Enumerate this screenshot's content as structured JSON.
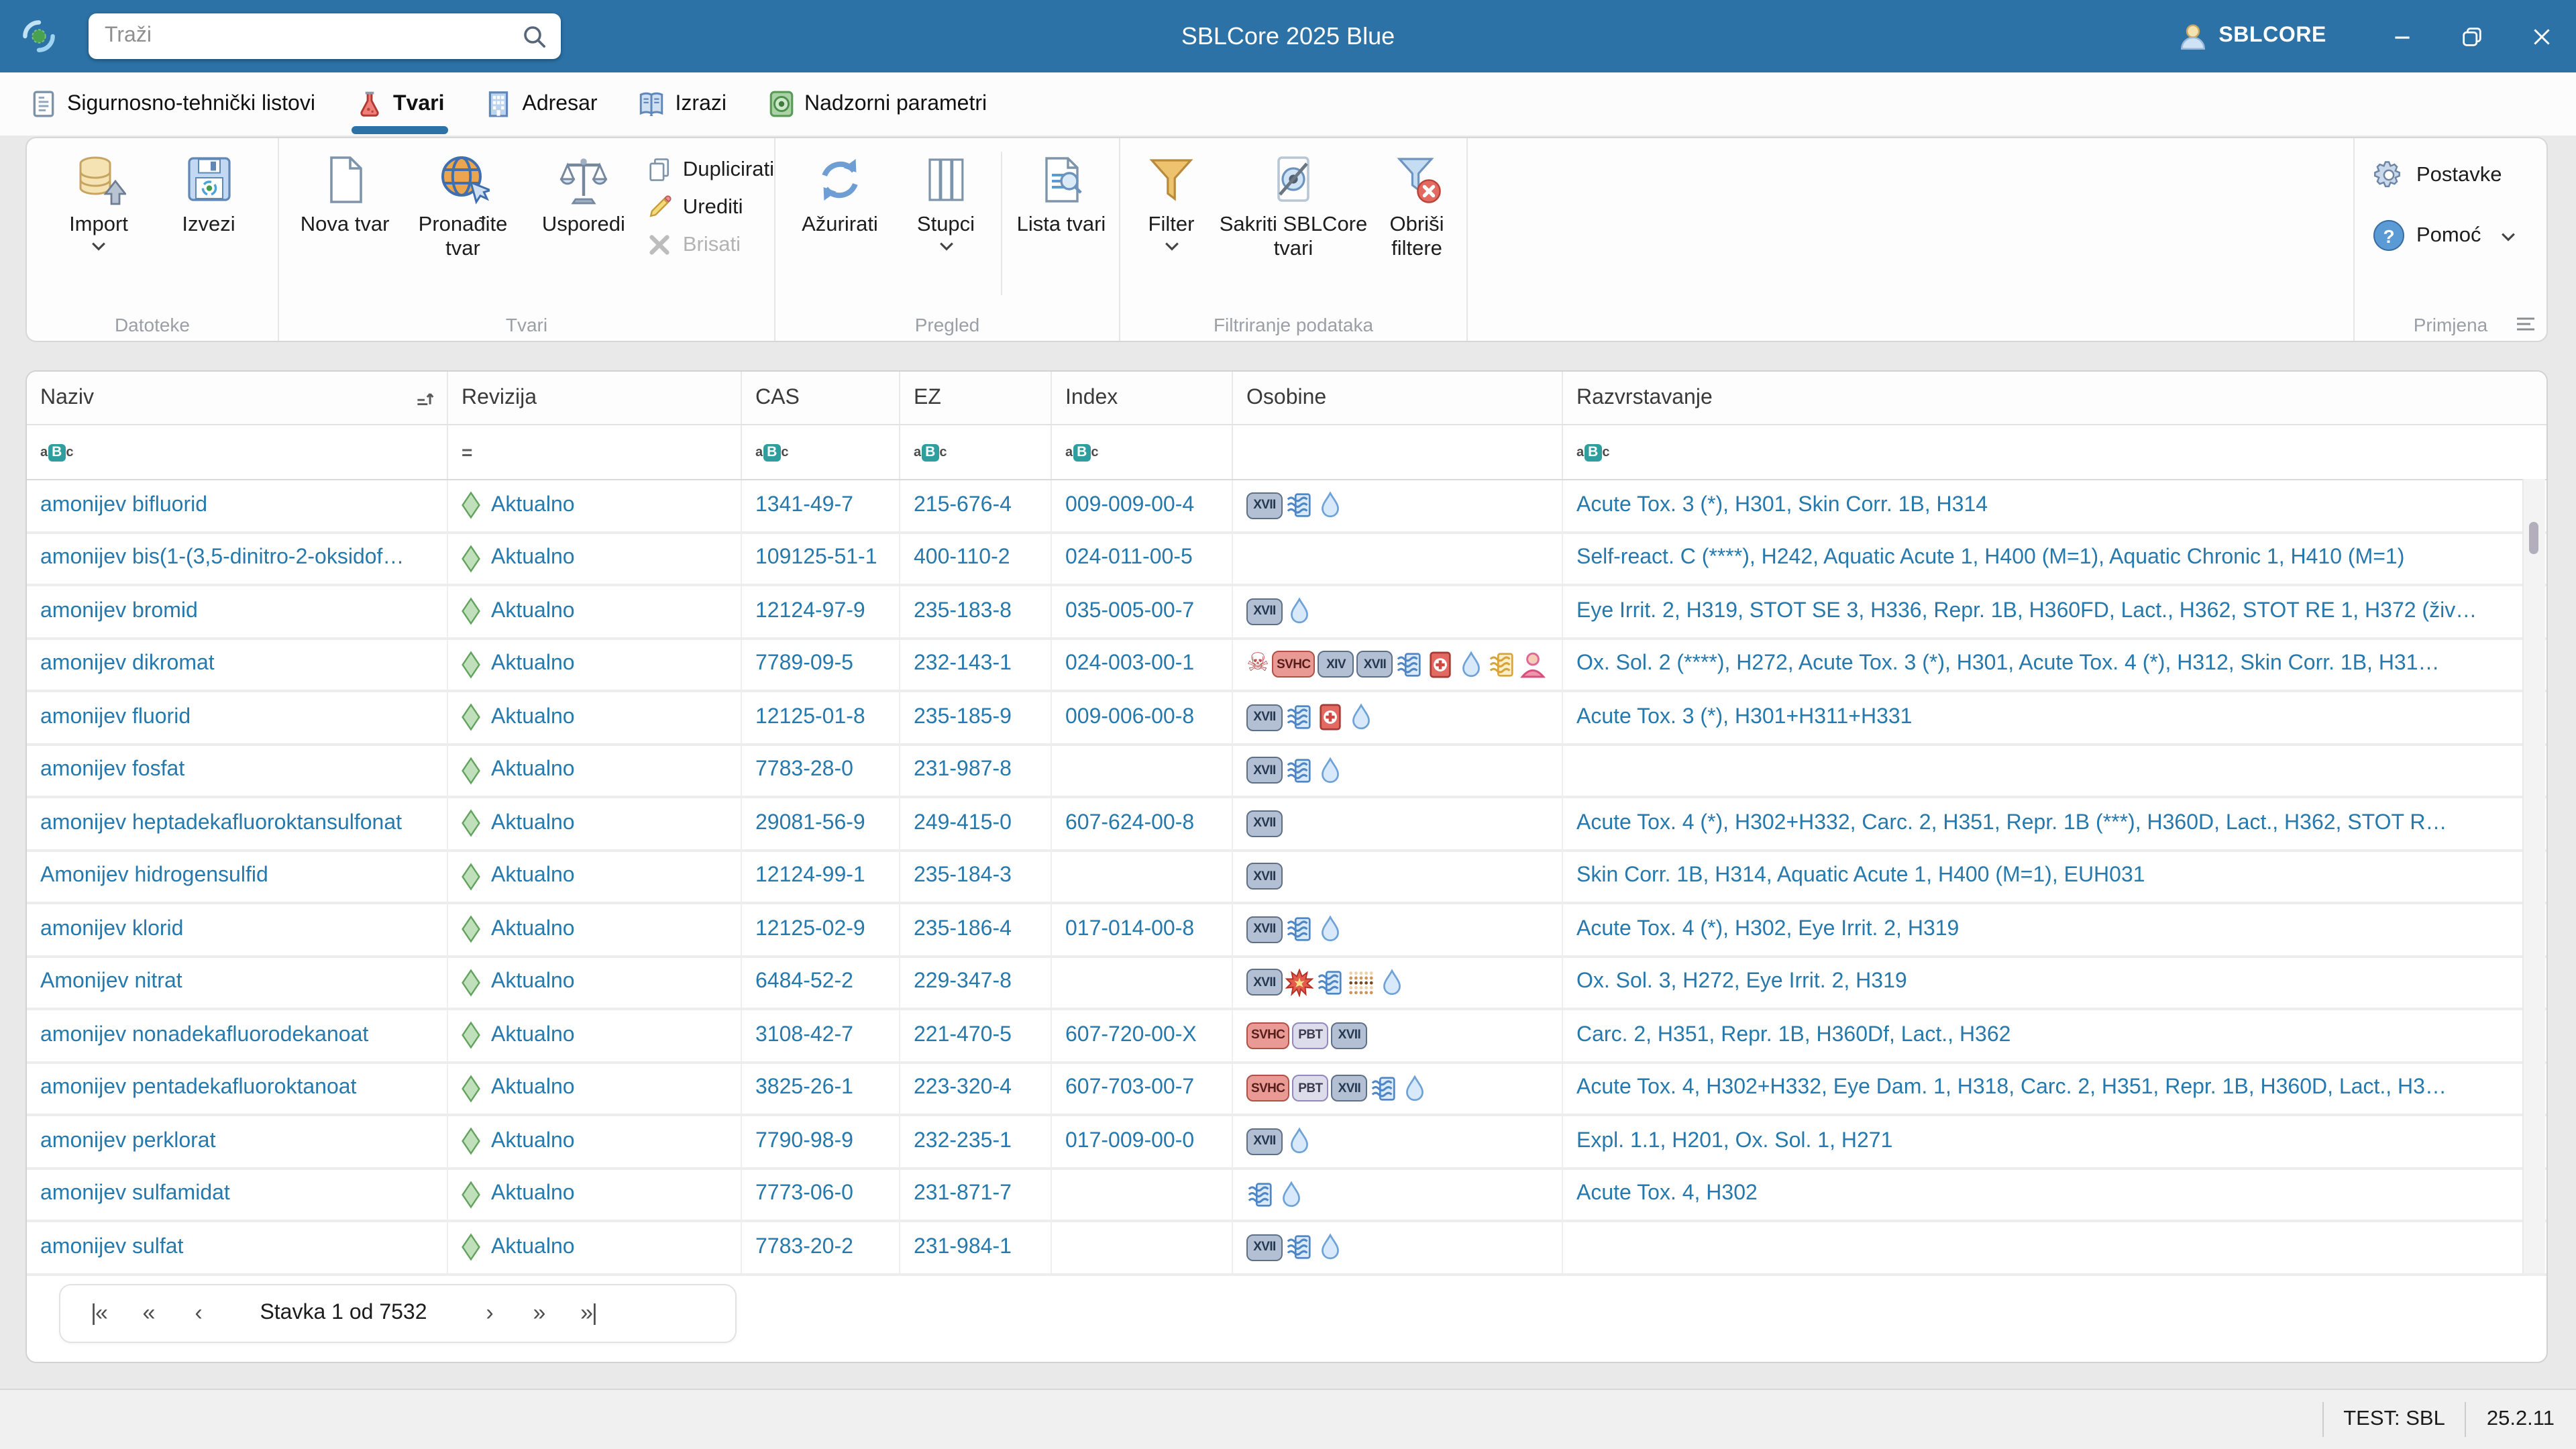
{
  "window": {
    "title": "SBLCore 2025 Blue",
    "user": "SBLCORE",
    "search_placeholder": "Traži"
  },
  "tabs": [
    {
      "label": "Sigurnosno-tehnički listovi",
      "active": false
    },
    {
      "label": "Tvari",
      "active": true
    },
    {
      "label": "Adresar",
      "active": false
    },
    {
      "label": "Izrazi",
      "active": false
    },
    {
      "label": "Nadzorni parametri",
      "active": false
    }
  ],
  "ribbon": {
    "groups": [
      {
        "label": "Datoteke",
        "buttons": [
          {
            "label": "Import",
            "dropdown": true
          },
          {
            "label": "Izvezi",
            "dropdown": false
          }
        ]
      },
      {
        "label": "Tvari",
        "buttons": [
          {
            "label": "Nova tvar",
            "dropdown": false
          },
          {
            "label": "Pronađite tvar",
            "dropdown": false
          },
          {
            "label": "Usporedi",
            "dropdown": false
          }
        ],
        "small_buttons": [
          {
            "label": "Duplicirati",
            "disabled": false
          },
          {
            "label": "Urediti",
            "disabled": false
          },
          {
            "label": "Brisati",
            "disabled": true
          }
        ]
      },
      {
        "label": "Pregled",
        "buttons": [
          {
            "label": "Ažurirati",
            "dropdown": false
          },
          {
            "label": "Stupci",
            "dropdown": true
          },
          {
            "label": "Lista tvari",
            "dropdown": false
          }
        ]
      },
      {
        "label": "Filtriranje podataka",
        "buttons": [
          {
            "label": "Filter",
            "dropdown": true
          },
          {
            "label": "Sakriti SBLCore tvari",
            "dropdown": false
          },
          {
            "label": "Obriši filtere",
            "dropdown": false
          }
        ]
      },
      {
        "label": "Primjena",
        "buttons": [
          {
            "label": "Postavke",
            "dropdown": false
          },
          {
            "label": "Pomoć",
            "dropdown": true
          }
        ]
      }
    ]
  },
  "table": {
    "columns": [
      {
        "label": "Naziv",
        "filter": "abc",
        "sorted": true
      },
      {
        "label": "Revizija",
        "filter": "eq",
        "sorted": false
      },
      {
        "label": "CAS",
        "filter": "abc",
        "sorted": false
      },
      {
        "label": "EZ",
        "filter": "abc",
        "sorted": false
      },
      {
        "label": "Index",
        "filter": "abc",
        "sorted": false
      },
      {
        "label": "Osobine",
        "filter": null,
        "sorted": false
      },
      {
        "label": "Razvrstavanje",
        "filter": "abc",
        "sorted": false
      }
    ],
    "rows": [
      {
        "name": "amonijev bifluorid",
        "revision": "Aktualno",
        "cas": "1341-49-7",
        "ez": "215-676-4",
        "index": "009-009-00-4",
        "props": [
          "reach-xvii",
          "vapour",
          "droplet"
        ],
        "classification": "Acute Tox. 3 (*), H301, Skin Corr. 1B, H314"
      },
      {
        "name": "amonijev bis(1-(3,5-dinitro-2-oksidof…",
        "revision": "Aktualno",
        "cas": "109125-51-1",
        "ez": "400-110-2",
        "index": "024-011-00-5",
        "props": [],
        "classification": "Self-react. C (****), H242, Aquatic Acute 1, H400 (M=1), Aquatic Chronic 1, H410 (M=1)"
      },
      {
        "name": "amonijev bromid",
        "revision": "Aktualno",
        "cas": "12124-97-9",
        "ez": "235-183-8",
        "index": "035-005-00-7",
        "props": [
          "reach-xvii",
          "droplet"
        ],
        "classification": "Eye Irrit. 2, H319, STOT SE 3, H336, Repr. 1B, H360FD, Lact., H362, STOT RE 1, H372 (živ…"
      },
      {
        "name": "amonijev dikromat",
        "revision": "Aktualno",
        "cas": "7789-09-5",
        "ez": "232-143-1",
        "index": "024-003-00-1",
        "props": [
          "skull",
          "svhc",
          "reach-xiv",
          "reach-xvii",
          "vapour",
          "first-aid",
          "droplet",
          "vapour-warm",
          "person"
        ],
        "classification": "Ox. Sol. 2 (****), H272, Acute Tox. 3 (*), H301, Acute Tox. 4 (*), H312, Skin Corr. 1B, H31…"
      },
      {
        "name": "amonijev fluorid",
        "revision": "Aktualno",
        "cas": "12125-01-8",
        "ez": "235-185-9",
        "index": "009-006-00-8",
        "props": [
          "reach-xvii",
          "vapour",
          "first-aid",
          "droplet"
        ],
        "classification": "Acute Tox. 3 (*), H301+H311+H331"
      },
      {
        "name": "amonijev fosfat",
        "revision": "Aktualno",
        "cas": "7783-28-0",
        "ez": "231-987-8",
        "index": "",
        "props": [
          "reach-xvii",
          "vapour",
          "droplet"
        ],
        "classification": ""
      },
      {
        "name": "amonijev heptadekafluoroktansulfonat",
        "revision": "Aktualno",
        "cas": "29081-56-9",
        "ez": "249-415-0",
        "index": "607-624-00-8",
        "props": [
          "reach-xvii"
        ],
        "classification": "Acute Tox. 4 (*), H302+H332, Carc. 2, H351, Repr. 1B (***), H360D, Lact., H362, STOT R…"
      },
      {
        "name": "Amonijev hidrogensulfid",
        "revision": "Aktualno",
        "cas": "12124-99-1",
        "ez": "235-184-3",
        "index": "",
        "props": [
          "reach-xvii"
        ],
        "classification": "Skin Corr. 1B, H314, Aquatic Acute 1, H400 (M=1), EUH031"
      },
      {
        "name": "amonijev klorid",
        "revision": "Aktualno",
        "cas": "12125-02-9",
        "ez": "235-186-4",
        "index": "017-014-00-8",
        "props": [
          "reach-xvii",
          "vapour",
          "droplet"
        ],
        "classification": "Acute Tox. 4 (*), H302, Eye Irrit. 2, H319"
      },
      {
        "name": "Amonijev nitrat",
        "revision": "Aktualno",
        "cas": "6484-52-2",
        "ez": "229-347-8",
        "index": "",
        "props": [
          "reach-xvii",
          "explosion",
          "vapour",
          "dust",
          "droplet"
        ],
        "classification": "Ox. Sol. 3, H272, Eye Irrit. 2, H319"
      },
      {
        "name": "amonijev nonadekafluorodekanoat",
        "revision": "Aktualno",
        "cas": "3108-42-7",
        "ez": "221-470-5",
        "index": "607-720-00-X",
        "props": [
          "svhc",
          "pbt",
          "reach-xvii"
        ],
        "classification": "Carc. 2, H351, Repr. 1B, H360Df, Lact., H362"
      },
      {
        "name": "amonijev pentadekafluoroktanoat",
        "revision": "Aktualno",
        "cas": "3825-26-1",
        "ez": "223-320-4",
        "index": "607-703-00-7",
        "props": [
          "svhc",
          "pbt",
          "reach-xvii",
          "vapour",
          "droplet"
        ],
        "classification": "Acute Tox. 4, H302+H332, Eye Dam. 1, H318, Carc. 2, H351, Repr. 1B, H360D, Lact., H3…"
      },
      {
        "name": "amonijev perklorat",
        "revision": "Aktualno",
        "cas": "7790-98-9",
        "ez": "232-235-1",
        "index": "017-009-00-0",
        "props": [
          "reach-xvii",
          "droplet"
        ],
        "classification": "Expl. 1.1, H201, Ox. Sol. 1, H271"
      },
      {
        "name": "amonijev sulfamidat",
        "revision": "Aktualno",
        "cas": "7773-06-0",
        "ez": "231-871-7",
        "index": "",
        "props": [
          "vapour",
          "droplet"
        ],
        "classification": "Acute Tox. 4, H302"
      },
      {
        "name": "amonijev sulfat",
        "revision": "Aktualno",
        "cas": "7783-20-2",
        "ez": "231-984-1",
        "index": "",
        "props": [
          "reach-xvii",
          "vapour",
          "droplet"
        ],
        "classification": ""
      }
    ]
  },
  "pagination": {
    "label": "Stavka 1 od 7532",
    "buttons": [
      {
        "name": "first",
        "glyph": "|«"
      },
      {
        "name": "prev-fast",
        "glyph": "«"
      },
      {
        "name": "prev",
        "glyph": "‹"
      },
      {
        "name": "next",
        "glyph": "›"
      },
      {
        "name": "next-fast",
        "glyph": "»"
      },
      {
        "name": "last",
        "glyph": "»|"
      }
    ]
  },
  "statusbar": {
    "environment": "TEST: SBL",
    "version": "25.2.11"
  }
}
